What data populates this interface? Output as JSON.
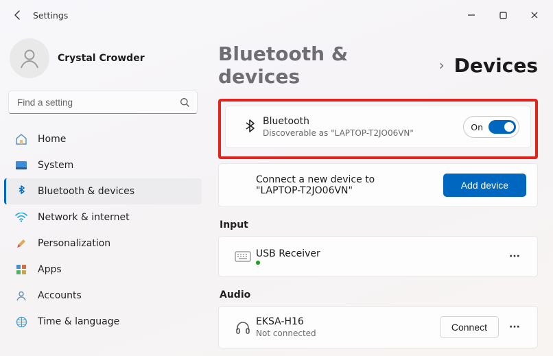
{
  "window": {
    "title": "Settings"
  },
  "profile": {
    "name": "Crystal Crowder"
  },
  "search": {
    "placeholder": "Find a setting"
  },
  "sidebar": {
    "items": [
      {
        "label": "Home"
      },
      {
        "label": "System"
      },
      {
        "label": "Bluetooth & devices"
      },
      {
        "label": "Network & internet"
      },
      {
        "label": "Personalization"
      },
      {
        "label": "Apps"
      },
      {
        "label": "Accounts"
      },
      {
        "label": "Time & language"
      }
    ]
  },
  "breadcrumb": {
    "parent": "Bluetooth & devices",
    "current": "Devices"
  },
  "bluetooth_card": {
    "title": "Bluetooth",
    "subtitle": "Discoverable as \"LAPTOP-T2JO06VN\"",
    "toggle_label": "On"
  },
  "add_device": {
    "text": "Connect a new device to \"LAPTOP-T2JO06VN\"",
    "button": "Add device"
  },
  "sections": {
    "input": {
      "heading": "Input",
      "device_name": "USB Receiver"
    },
    "audio": {
      "heading": "Audio",
      "device_name": "EKSA-H16",
      "device_status": "Not connected",
      "connect_label": "Connect"
    }
  }
}
